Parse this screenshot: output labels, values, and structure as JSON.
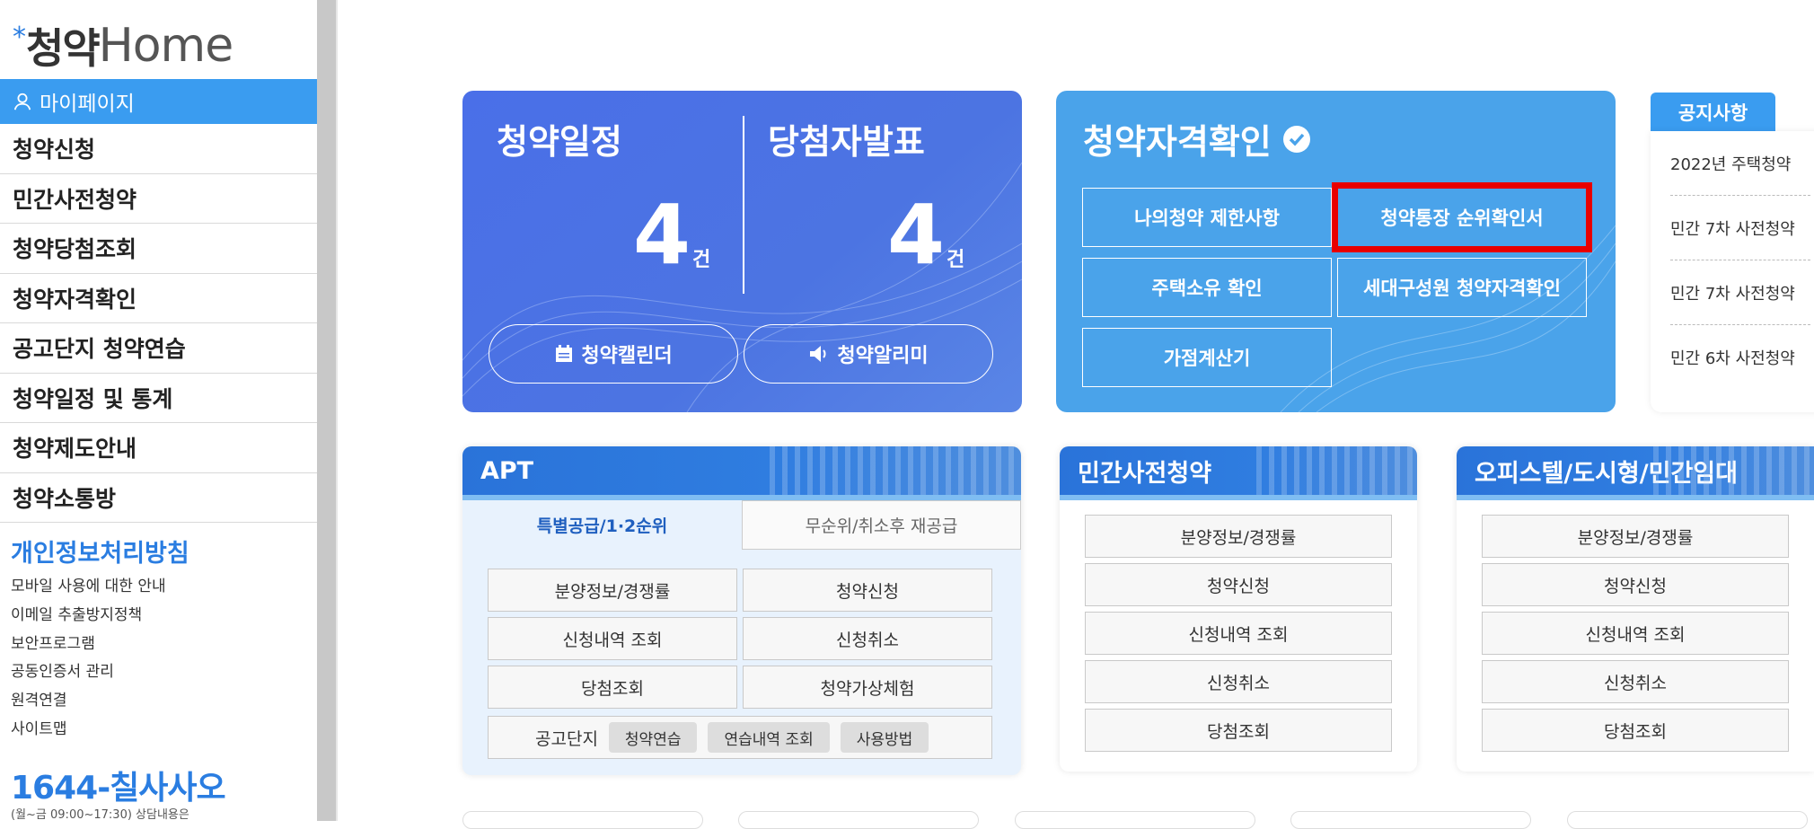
{
  "sidebar": {
    "logo": {
      "kor": "청약",
      "eng": "Home"
    },
    "mypage_label": "마이페이지",
    "menu": [
      "청약신청",
      "민간사전청약",
      "청약당첨조회",
      "청약자격확인",
      "공고단지 청약연습",
      "청약일정 및 통계",
      "청약제도안내",
      "청약소통방"
    ],
    "policy": "개인정보처리방침",
    "links": [
      "모바일 사용에 대한 안내",
      "이메일 추출방지정책",
      "보안프로그램",
      "공동인증서 관리",
      "원격연결",
      "사이트맵"
    ],
    "phone": "1644-칠사사오",
    "hours": "(월~금 09:00~17:30) 상담내용은"
  },
  "schedule": {
    "left_title": "청약일정",
    "left_count": "4",
    "right_title": "당첨자발표",
    "right_count": "4",
    "unit": "건",
    "calendar_btn": "청약캘린더",
    "alarm_btn": "청약알리미"
  },
  "qualification": {
    "title": "청약자격확인",
    "buttons": [
      "나의청약 제한사항",
      "청약통장 순위확인서",
      "주택소유 확인",
      "세대구성원 청약자격확인",
      "가점계산기"
    ]
  },
  "notice": {
    "tab": "공지사항",
    "items": [
      "2022년 주택청약",
      "민간 7차 사전청약",
      "민간 7차 사전청약",
      "민간 6차 사전청약"
    ]
  },
  "apt": {
    "title": "APT",
    "tab_active": "특별공급/1·2순위",
    "tab_inactive": "무순위/취소후 재공급",
    "buttons": [
      "분양정보/경쟁률",
      "청약신청",
      "신청내역 조회",
      "신청취소",
      "당첨조회",
      "청약가상체험"
    ],
    "gogo_label": "공고단지",
    "chips": [
      "청약연습",
      "연습내역 조회",
      "사용방법"
    ]
  },
  "presale": {
    "title": "민간사전청약",
    "buttons": [
      "분양정보/경쟁률",
      "청약신청",
      "신청내역 조회",
      "신청취소",
      "당첨조회"
    ]
  },
  "officetel": {
    "title": "오피스텔/도시형/민간임대",
    "buttons": [
      "분양정보/경쟁률",
      "청약신청",
      "신청내역 조회",
      "신청취소",
      "당첨조회"
    ]
  }
}
